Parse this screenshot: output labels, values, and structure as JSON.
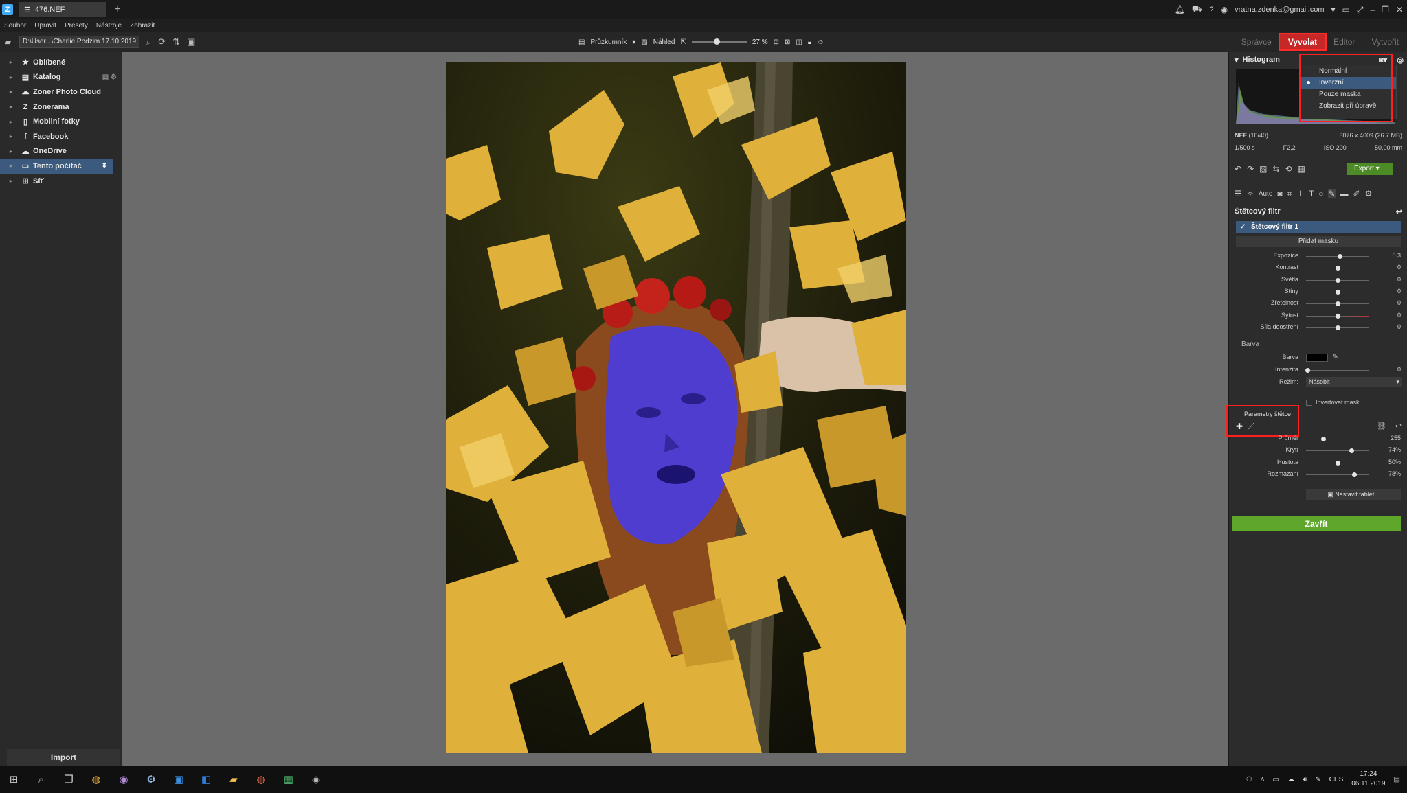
{
  "window": {
    "tab_title": "476.NEF",
    "user_email": "vratna.zdenka@gmail.com"
  },
  "menu": [
    "Soubor",
    "Upravit",
    "Presety",
    "Nástroje",
    "Zobrazit"
  ],
  "toolbar": {
    "path": "D:\\User...\\Charlie Podzim 17.10.2019",
    "explorer_label": "Průzkumník",
    "preview_label": "Náhled",
    "zoom": "27 %"
  },
  "modes": {
    "manager": "Správce",
    "develop": "Vyvolat",
    "editor": "Editor",
    "create": "Vytvořit"
  },
  "sidebar": {
    "items": [
      {
        "label": "Oblíbené",
        "icon": "star-icon",
        "glyph": "★"
      },
      {
        "label": "Katalog",
        "icon": "catalog-icon",
        "glyph": "▤"
      },
      {
        "label": "Zoner Photo Cloud",
        "icon": "cloud-icon",
        "glyph": "☁"
      },
      {
        "label": "Zonerama",
        "icon": "zonerama-icon",
        "glyph": "Z"
      },
      {
        "label": "Mobilní fotky",
        "icon": "phone-icon",
        "glyph": "▯"
      },
      {
        "label": "Facebook",
        "icon": "facebook-icon",
        "glyph": "f"
      },
      {
        "label": "OneDrive",
        "icon": "onedrive-icon",
        "glyph": "☁"
      },
      {
        "label": "Tento počítač",
        "icon": "computer-icon",
        "glyph": "▭"
      },
      {
        "label": "Síť",
        "icon": "network-icon",
        "glyph": "⊞"
      }
    ],
    "import_label": "Import"
  },
  "histogram": {
    "title": "Histogram",
    "options": [
      "Normální",
      "Inverzní",
      "Pouze maska",
      "Zobrazit při úpravě"
    ],
    "selected": "Inverzní"
  },
  "file_info": {
    "format": "NEF",
    "index": "(10/40)",
    "dimensions": "3076 x 4609 (26.7 MB)",
    "shutter": "1/500 s",
    "aperture": "F2,2",
    "iso": "ISO 200",
    "focal": "50,00 mm"
  },
  "actions": {
    "export_label": "Export",
    "auto_label": "Auto"
  },
  "brush_filter": {
    "title": "Štětcový filtr",
    "item_label": "Štětcový filtr 1",
    "add_mask_label": "Přidat masku",
    "sliders": [
      {
        "label": "Expozice",
        "value": "0.3",
        "pos": 0.53
      },
      {
        "label": "Kontrast",
        "value": "0",
        "pos": 0.5
      },
      {
        "label": "Světla",
        "value": "0",
        "pos": 0.5
      },
      {
        "label": "Stíny",
        "value": "0",
        "pos": 0.5
      },
      {
        "label": "Zřetelnost",
        "value": "0",
        "pos": 0.5
      },
      {
        "label": "Sytost",
        "value": "0",
        "pos": 0.5
      },
      {
        "label": "Síla doostření",
        "value": "0",
        "pos": 0.5
      }
    ],
    "color_section": "Barva",
    "color_label": "Barva",
    "intensity_label": "Intenzita",
    "intensity_value": "0",
    "intensity_pos": 0.02,
    "mode_label": "Režim:",
    "mode_value": "Násobit",
    "invert_mask_label": "Invertovat masku",
    "brush_params_label": "Parametry štětce",
    "brush_sliders": [
      {
        "label": "Průměr",
        "value": "255",
        "pos": 0.27
      },
      {
        "label": "Krytí",
        "value": "74%",
        "pos": 0.72
      },
      {
        "label": "Hustota",
        "value": "50%",
        "pos": 0.5
      },
      {
        "label": "Rozmazání",
        "value": "78%",
        "pos": 0.76
      }
    ],
    "tablet_label": "Nastavit tablet...",
    "close_label": "Zavřít"
  },
  "taskbar": {
    "language": "CES",
    "time": "17:24",
    "date": "06.11.2019"
  },
  "colors": {
    "accent_red": "#c62828",
    "highlight_red": "#ff1f1f",
    "selection_blue": "#3c5a7d",
    "close_green": "#5ea72b",
    "mask_overlay": "#4a3ce0"
  }
}
